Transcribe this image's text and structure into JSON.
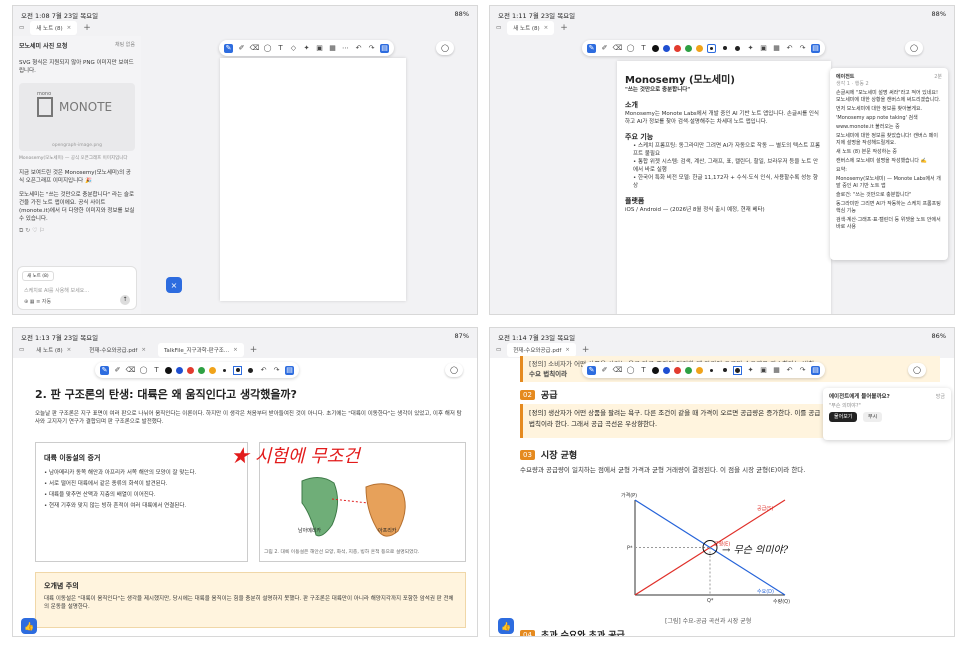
{
  "p1": {
    "time": "오전 1:08  7월 23일 목요일",
    "battery": "88%",
    "tab": "새 노트 (8)",
    "sidebar_title": "모노세미 사진 요청",
    "sidebar_sub": "채팅 없음",
    "msg1": "SVG 형식은 지원되지 않아 PNG 이미지만 보여드립니다.",
    "logo_top": "mono",
    "logo": "MONOTE",
    "img_caption": "opengraph-image.png",
    "src": "Monosemy(모노세미) — 공식 오픈그래프 이미지입니다",
    "msg2": "지금 보여드린 것은 Monosemy(모노세미)의 공식 오픈그래프 이미지입니다 🎉",
    "msg3": "모노세미는 \"쓰는 것만으로 충분합니다\" 라는 슬로건을 가진 노트 앱이에요. 공식 사이트(monote.it)에서 더 다양한 이미지와 정보를 보실 수 있습니다.",
    "chip": "새 노트 (8)",
    "input_ph": "스케치로 AI를 사용해 보세요...",
    "model": "자동"
  },
  "p2": {
    "time": "오전 1:11  7월 23일 목요일",
    "battery": "88%",
    "tab": "새 노트 (8)",
    "doc_title": "Monosemy (모노세미)",
    "doc_sub": "\"쓰는 것만으로 충분합니다\"",
    "s_intro": "소개",
    "intro": "Monosemy는 Monote Labs에서 개발 중인 AI 기반 노트 앱입니다. 손글씨를 인식하고 AI가 정보를 찾아 검색·설명해주는 차세대 노트 앱입니다.",
    "s_feat": "주요 기능",
    "f1": "스케치 프롬프팅: 동그라미만 그려면 AI가 자동으로 작동 — 별도의 텍스트 프롬프트 불필요",
    "f2": "통합 위젯 시스템: 검색, 계산, 그래프, 표, 캘린더, 할일, 브라우저 등을 노트 안에서 바로 실행",
    "f3": "한국어 특화 비전 모델: 한글 11,172자 + 수식·도식 인식, 사용할수록 성능 향상",
    "s_plat": "플랫폼",
    "plat": "iOS / Android — (2026년 8월 정식 출시 예정, 현재 베타)",
    "ai_head": "에이전트",
    "ai_sub": "생각 1 · 행동 2",
    "ai_time": "2분",
    "ai_lines": [
      "손글씨에 \"모노세미 설명 써라\"라고 적어 있네요! 모노세미에 대한 상황을 캔버스에 써드리겠습니다.",
      "먼저 모노세미에 대한 정보를 찾아볼게요.",
      "'Monosemy app note taking' 검색",
      "www.monote.it 불러오는 중",
      "모노세미에 대한 정보를 찾았습니다! 캔버스 페이지에 설명을 작성해드릴게요.",
      "새 노트 (8) 본문 작성하는 중",
      "캔버스에 모노세미 설명을 작성했습니다 ✍️",
      "요약:",
      "Monosemy(모노세미) — Monote Labs에서 개발 중인 AI 기반 노트 앱",
      "슬로건: \"쓰는 것만으로 충분합니다\"",
      "동그라미만 그리면 AI가 작동하는 스케치 프롬프팅 핵심 기능",
      "검색·계산·그래프·표·캘린더 등 위젯을 노트 안에서 바로 사용"
    ]
  },
  "p3": {
    "time": "오전 1:13  7월 23일 목요일",
    "battery": "87%",
    "tabs": [
      "새 노트 (8)",
      "현재-수요와공급.pdf",
      "TalkFile_지구과학-판구조..."
    ],
    "heading": "2. 판 구조론의 탄생: 대륙은 왜 움직인다고 생각했을까?",
    "para": "오늘날 판 구조론은 지구 표면이 여러 판으로 나뉘어 움직인다는 이론이다. 하지만 이 생각은 처음부터 받아들여진 것이 아니다. 초기에는 \"대륙이 이동한다\"는 생각이 있었고, 이후 해저 탐사와 고지자기 연구가 결합되며 판 구조론으로 발전했다.",
    "box_title": "대륙 이동설의 증거",
    "bullets": [
      "남아메리카 동쪽 해안과 아프리카 서쪽 해안의 모양이 잘 맞는다.",
      "서로 떨어진 대륙에서 같은 종류의 화석이 발견된다.",
      "대륙을 맞추면 산맥과 지층의 배열이 이어진다.",
      "현재 기후와 맞지 않는 빙하 흔적이 여러 대륙에서 연결된다."
    ],
    "handwriting": "★ 시험에 무조건",
    "fig_l": "남아메리카",
    "fig_r": "아프리카",
    "fig_cap": "그림 2. 대륙 이동설은 해안선 모양, 화석, 지층, 빙하 흔적 등으로 설명되었다.",
    "note_title": "오개념 주의",
    "note": "대륙 이동설은 \"대륙이 움직인다\"는 생각을 제시했지만, 당시에는 대륙을 움직이는 힘을 충분히 설명하지 못했다. 판 구조론은 대륙만이 아니라 해양지각까지 포함한 암석권 판 전체의 운동을 설명한다."
  },
  "p4": {
    "time": "오전 1:14  7월 23일 목요일",
    "battery": "86%",
    "tab": "현재-수요와공급.pdf",
    "top_def": "[정의] 소비자가 어떤 상품을 사려는 욕구 다른 조건이 일정할 때 가격이 오르면 수요량은 감소한다는 법칙",
    "top_def2": "수요 법칙이라",
    "n2": "02",
    "s2": "공급",
    "def2": "[정의] 생산자가 어떤 상품을 팔려는 욕구. 다른 조건이 같을 때 가격이 오르면 공급량은 증가한다. 이를 공급 법칙이라 한다. 그래서 공급 곡선은 우상향한다.",
    "n3": "03",
    "s3": "시장 균형",
    "p3": "수요량과 공급량이 일치하는 점에서 균형 가격과 균형 거래량이 결정된다. 이 점을 시장 균형(E)이라 한다.",
    "g_y": "가격(P)",
    "g_x": "수량(Q)",
    "g_s": "공급(S)",
    "g_d": "수요(D)",
    "g_e": "균형(E)",
    "g_p": "P*",
    "g_q": "Q*",
    "hw": "→ 무슨 의미야?",
    "cap": "[그림] 수요-공급 곡선과 시장 균형",
    "n4": "04",
    "s4": "초과 수요와 초과 공급",
    "popup_title": "에이전트에게 물어볼까요?",
    "popup_time": "방금",
    "popup_q": "\"무슨 의미야?\"",
    "popup_yes": "물어보기",
    "popup_no": "무시",
    "chart_data": {
      "type": "line",
      "xlabel": "수량(Q)",
      "ylabel": "가격(P)",
      "series": [
        {
          "name": "공급(S)",
          "points": [
            [
              0,
              0
            ],
            [
              10,
              10
            ]
          ]
        },
        {
          "name": "수요(D)",
          "points": [
            [
              0,
              10
            ],
            [
              10,
              0
            ]
          ]
        }
      ],
      "equilibrium": {
        "label": "균형(E)",
        "x_label": "Q*",
        "y_label": "P*"
      }
    }
  }
}
